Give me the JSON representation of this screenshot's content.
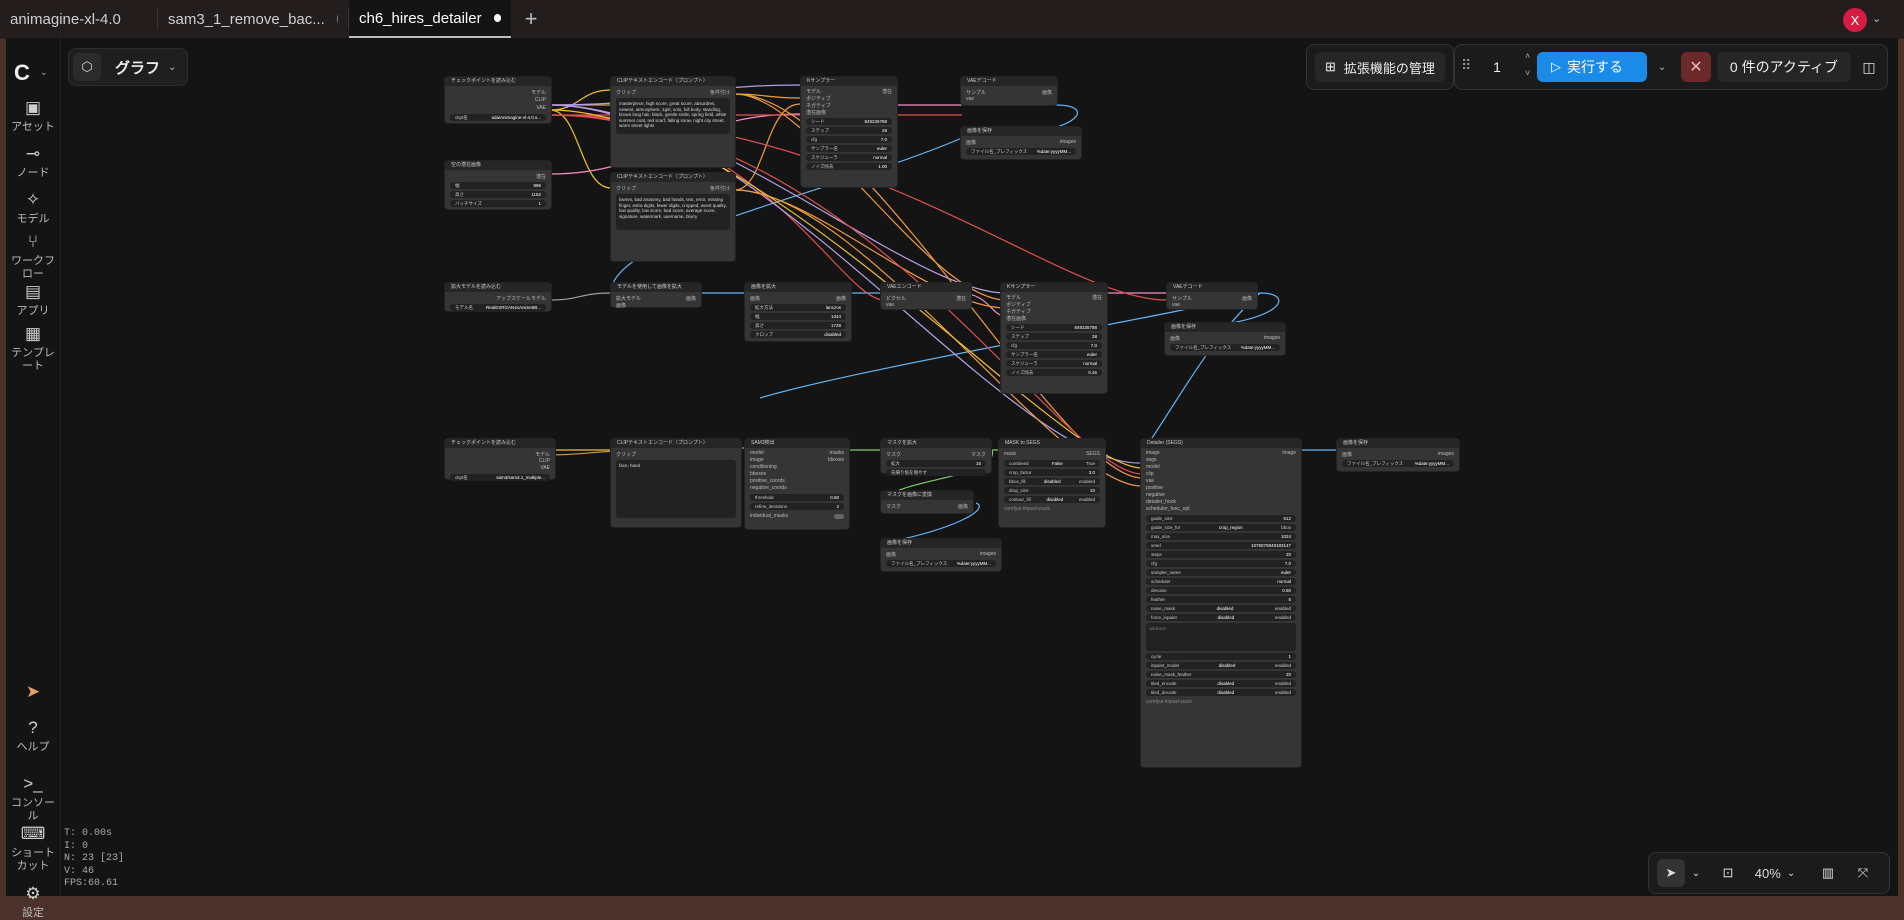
{
  "tabs": [
    {
      "label": "animagine-xl-4.0",
      "modified": false
    },
    {
      "label": "sam3_1_remove_bac...",
      "modified": true
    },
    {
      "label": "ch6_hires_detailer",
      "modified": true,
      "active": true
    }
  ],
  "user_initial": "X",
  "sidebar": {
    "items": [
      {
        "label": "アセット",
        "icon": "image-icon"
      },
      {
        "label": "ノード",
        "icon": "node-icon"
      },
      {
        "label": "モデル",
        "icon": "model-icon"
      },
      {
        "label": "ワークフロー",
        "icon": "workflow-icon"
      },
      {
        "label": "アプリ",
        "icon": "app-icon"
      },
      {
        "label": "テンプレート",
        "icon": "template-icon"
      }
    ],
    "bottom": [
      {
        "label": "ヘルプ",
        "icon": "help-icon"
      },
      {
        "label": "コンソール",
        "icon": "console-icon"
      },
      {
        "label": "ショートカット",
        "icon": "keyboard-icon"
      },
      {
        "label": "設定",
        "icon": "gear-icon"
      }
    ]
  },
  "toolbar": {
    "graph_label": "グラフ",
    "extensions_label": "拡張機能の管理",
    "queue_count": "1",
    "run_label": "実行する",
    "active_label": "0 件のアクティブ",
    "zoom_label": "40%"
  },
  "stats": {
    "t": "T: 0.00s",
    "i": "I: 0",
    "n": "N: 23 [23]",
    "v": "V: 46",
    "fps": "FPS:60.61"
  },
  "colors": {
    "accent": "#1a8be8",
    "stop": "#6b2a2a",
    "avatar": "#d81b42",
    "frame": "#4a3129"
  },
  "nodes": {
    "ckpt1": {
      "title": "チェックポイントを読み込む",
      "outs": [
        "モデル",
        "CLIP",
        "VAE"
      ],
      "ckpt_label": "ckpt名",
      "ckpt": "adaiAnimagine-xl-4.0.s..."
    },
    "latent": {
      "title": "空の潜在画像",
      "out": "潜在",
      "w_label": "幅",
      "w": "896",
      "h_label": "高さ",
      "h": "1152",
      "b_label": "バッチサイズ",
      "b": "1"
    },
    "clip_pos": {
      "title": "CLIPテキストエンコード（プロンプト）",
      "in": "クリップ",
      "out": "条件付け",
      "text": "masterpiece, high score, great score, absurdres, newest, atmosphere, 1girl, solo, full body, standing, brown long hair, black, gentle smile, spring field, white summer coat, red scarf, falling snow, night city street, warm street lights"
    },
    "clip_neg": {
      "title": "CLIPテキストエンコード（プロンプト）",
      "in": "クリップ",
      "out": "条件付け",
      "text": "lowres, bad anatomy, bad hands, text, error, missing finger, extra digits, fewer digits, cropped, worst quality, low quality, low score, bad score, average score, signature, watermark, username, blurry"
    },
    "ks1": {
      "title": "Kサンプラー",
      "ins": [
        "モデル",
        "ポジティブ",
        "ネガティブ",
        "潜在画像"
      ],
      "out": "潜在",
      "seed_label": "シード",
      "seed": "849235788",
      "steps_label": "ステップ",
      "steps": "28",
      "cfg_label": "cfg",
      "cfg": "7.0",
      "sampler_label": "サンプラー名",
      "sampler": "euler",
      "sched_label": "スケジューラ",
      "sched": "normal",
      "denoise_label": "ノイズ除去",
      "denoise": "1.00"
    },
    "vae1": {
      "title": "VAEデコード",
      "ins": [
        "サンプル",
        "vae"
      ],
      "out": "画像"
    },
    "save1": {
      "title": "画像を保存",
      "in": "画像",
      "out": "images",
      "prefix_label": "ファイル名_プレフィックス",
      "prefix": "%date:yyyyMM..."
    },
    "upload": {
      "title": "拡大モデルを読み込む",
      "out": "アップスケールモデル",
      "model_label": "モデル名",
      "model": "RealESRGAN4xAnime6B..."
    },
    "upscale": {
      "title": "モデルを使用して画像を拡大",
      "ins": [
        "拡大モデル",
        "画像"
      ],
      "out": "画像"
    },
    "scale": {
      "title": "画像を拡大",
      "in": "画像",
      "out": "画像",
      "method_label": "拡大方法",
      "method": "lanczos",
      "w_label": "幅",
      "w": "1344",
      "h_label": "高さ",
      "h": "1728",
      "crop_label": "クロップ",
      "crop": "disabled"
    },
    "vaeenc": {
      "title": "VAEエンコード",
      "ins": [
        "ピクセル",
        "vae"
      ],
      "out": "潜在"
    },
    "ks2": {
      "title": "Kサンプラー",
      "ins": [
        "モデル",
        "ポジティブ",
        "ネガティブ",
        "潜在画像"
      ],
      "out": "潜在",
      "seed_label": "シード",
      "seed": "849235788",
      "steps_label": "ステップ",
      "steps": "28",
      "cfg_label": "cfg",
      "cfg": "7.0",
      "sampler_label": "サンプラー名",
      "sampler": "euler",
      "sched_label": "スケジューラ",
      "sched": "normal",
      "denoise_label": "ノイズ除去",
      "denoise": "0.45"
    },
    "vae2": {
      "title": "VAEデコード",
      "ins": [
        "サンプル",
        "vae"
      ],
      "out": "画像"
    },
    "save2": {
      "title": "画像を保存",
      "in": "画像",
      "out": "images",
      "prefix_label": "ファイル名_プレフィックス",
      "prefix": "%date:yyyyMM..."
    },
    "ckpt2": {
      "title": "チェックポイントを読み込む",
      "outs": [
        "モデル",
        "CLIP",
        "VAE"
      ],
      "ckpt_label": "ckpt名",
      "ckpt": "sam3/sam3.1_multiple..."
    },
    "clip3": {
      "title": "CLIPテキストエンコード（プロンプト）",
      "in": "クリップ",
      "out": "",
      "text": "face, hand"
    },
    "sam": {
      "title": "SAM3検出",
      "ins": [
        "model",
        "image",
        "conditioning",
        "bboxes",
        "positive_coords",
        "negative_coords"
      ],
      "outs": [
        "masks",
        "bboxes"
      ],
      "threshold_label": "threshold",
      "threshold": "0.50",
      "refine_label": "refine_iterations",
      "refine": "2",
      "ind_label": "individual_masks"
    },
    "mask2img": {
      "title": "マスクを拡大",
      "ins": [
        "マスク"
      ],
      "out": "マスク",
      "amt_label": "拡大",
      "amt": "16",
      "taper_label": "先細り角を増やす"
    },
    "maskimg": {
      "title": "マスクを画像に変換",
      "in": "マスク",
      "out": "画像"
    },
    "save3": {
      "title": "画像を保存",
      "in": "画像",
      "out": "images",
      "prefix_label": "ファイル名_プレフィックス",
      "prefix": "%date:yyyyMM..."
    },
    "m2segs": {
      "title": "MASK to SEGS",
      "in": "mask",
      "out": "SEGS",
      "combined_label": "combined",
      "combined_off": "False",
      "combined_on": "True",
      "crop_label": "crop_factor",
      "crop": "3.0",
      "bbox_label": "bbox_fill",
      "bbox_off": "disabled",
      "bbox_on": "enabled",
      "drop_label": "drop_size",
      "drop": "10",
      "contour_label": "contour_fill",
      "contour_off": "disabled",
      "contour_on": "enabled",
      "footer": "comfyui-impact-pack"
    },
    "detailer": {
      "title": "Detailer (SEGS)",
      "ins": [
        "image",
        "segs",
        "model",
        "clip",
        "vae",
        "positive",
        "negative",
        "detailer_hook",
        "scheduler_func_opt"
      ],
      "out": "image",
      "fields": [
        {
          "label": "guide_size",
          "value": "512"
        },
        {
          "label": "guide_size_for",
          "value": "crop_region",
          "alt": "bbox"
        },
        {
          "label": "max_size",
          "value": "1024"
        },
        {
          "label": "seed",
          "value": "1079070848183147"
        },
        {
          "label": "steps",
          "value": "20"
        },
        {
          "label": "cfg",
          "value": "7.0"
        },
        {
          "label": "sampler_name",
          "value": "euler"
        },
        {
          "label": "scheduler",
          "value": "normal"
        },
        {
          "label": "denoise",
          "value": "0.50"
        },
        {
          "label": "feather",
          "value": "5"
        },
        {
          "label": "noise_mask",
          "value": "disabled",
          "alt": "enabled"
        },
        {
          "label": "force_inpaint",
          "value": "disabled",
          "alt": "enabled"
        }
      ],
      "wildcard": "wildcard",
      "fields2": [
        {
          "label": "cycle",
          "value": "1"
        },
        {
          "label": "inpaint_model",
          "value": "disabled",
          "alt": "enabled"
        },
        {
          "label": "noise_mask_feather",
          "value": "20"
        },
        {
          "label": "tiled_encode",
          "value": "disabled",
          "alt": "enabled"
        },
        {
          "label": "tiled_decode",
          "value": "disabled",
          "alt": "enabled"
        }
      ],
      "footer": "comfyui-impact-pack"
    },
    "save4": {
      "title": "画像を保存",
      "in": "画像",
      "out": "images",
      "prefix_label": "ファイル名_プレフィックス",
      "prefix": "%date:yyyyMM..."
    }
  }
}
